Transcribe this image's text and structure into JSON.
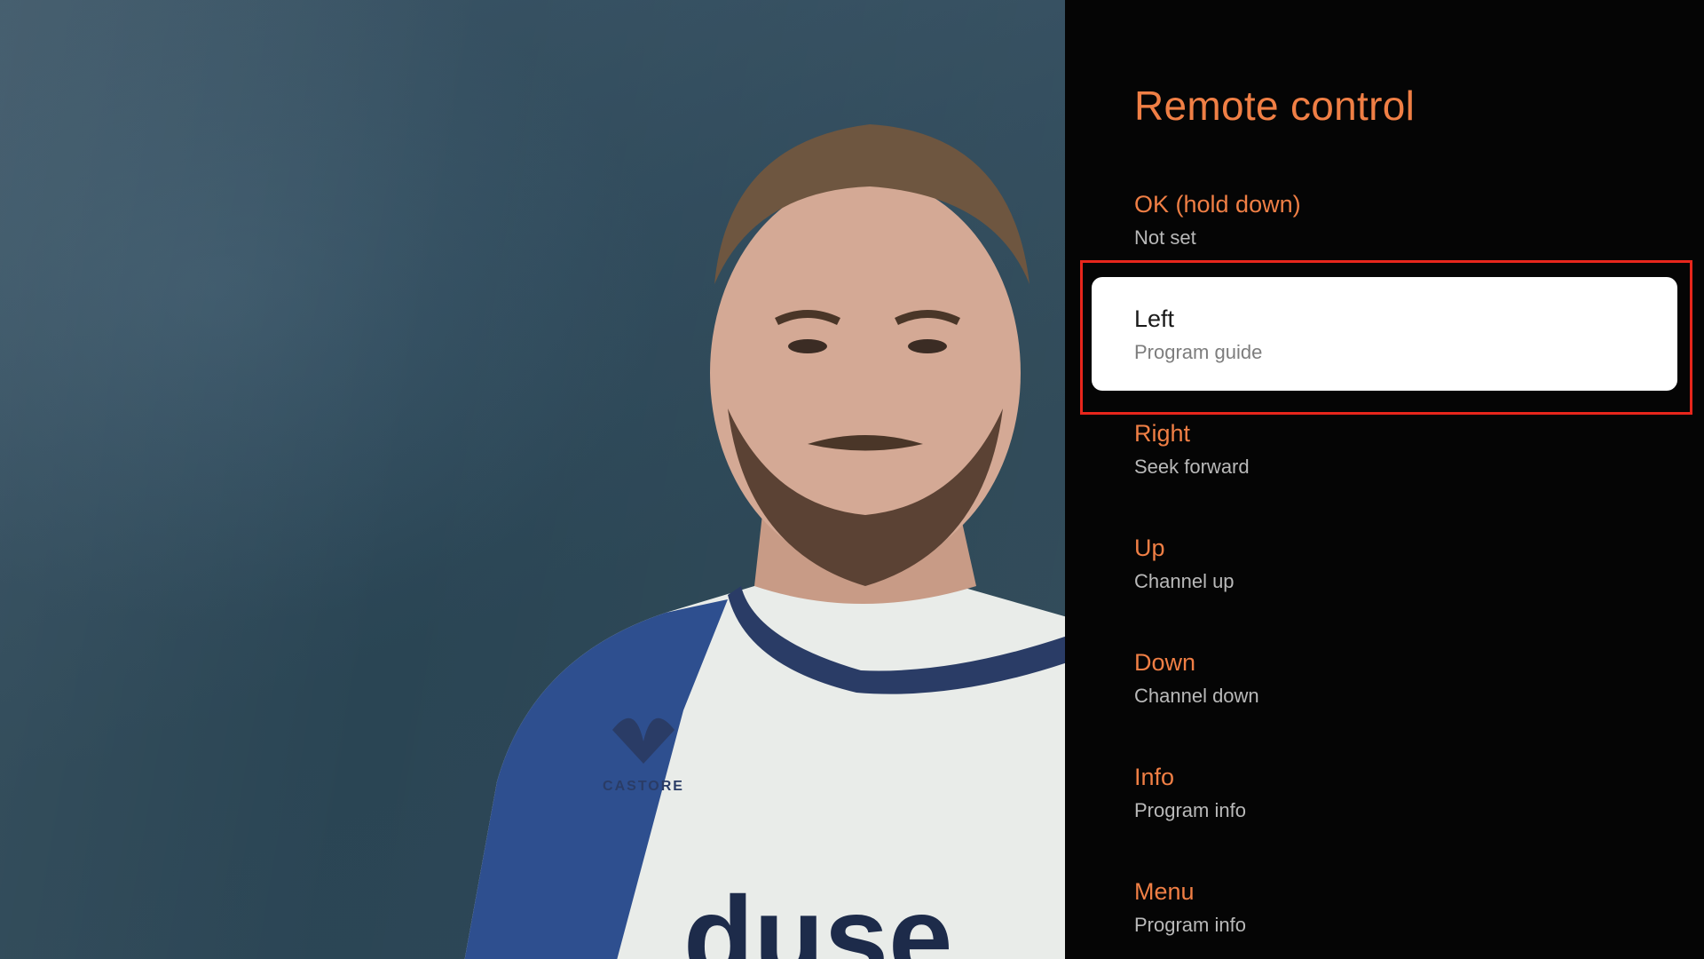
{
  "panel": {
    "title": "Remote control",
    "items": [
      {
        "label": "OK (hold down)",
        "value": "Not set"
      },
      {
        "label": "Left",
        "value": "Program guide"
      },
      {
        "label": "Right",
        "value": "Seek forward"
      },
      {
        "label": "Up",
        "value": "Channel up"
      },
      {
        "label": "Down",
        "value": "Channel down"
      },
      {
        "label": "Info",
        "value": "Program info"
      },
      {
        "label": "Menu",
        "value": "Program info"
      }
    ],
    "focused_index": 1
  },
  "video": {
    "jersey_brand": "CASTORE"
  },
  "colors": {
    "accent": "#f07f45",
    "focus_outline": "#e8261c",
    "panel_bg": "#050505",
    "card_bg": "#ffffff"
  }
}
